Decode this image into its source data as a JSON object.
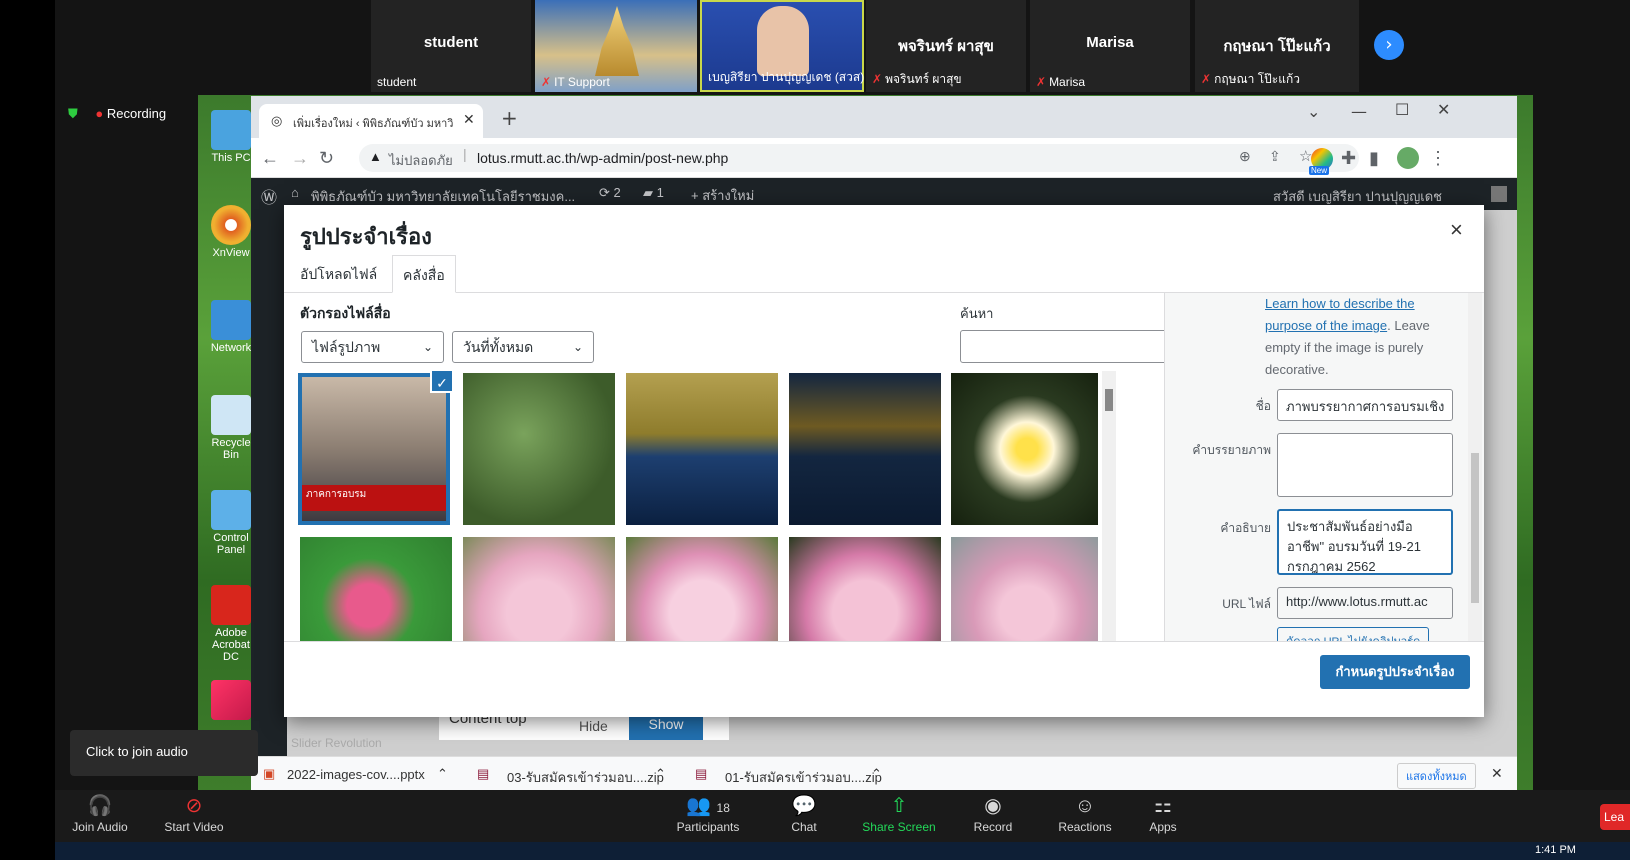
{
  "participants": [
    {
      "big": "student",
      "small": "student"
    },
    {
      "big": "",
      "small": "IT Support"
    },
    {
      "big": "",
      "small": "เบญสิรียา ปานปุญญเดช (สวส)"
    },
    {
      "big": "พจรินทร์ ผาสุข",
      "small": "พจรินทร์ ผาสุข"
    },
    {
      "big": "Marisa",
      "small": "Marisa"
    },
    {
      "big": "กฤษณา โป๊ะแก้ว",
      "small": "กฤษณา โป๊ะแก้ว"
    }
  ],
  "recording": "Recording",
  "desktop_icons": [
    "This PC",
    "XnView",
    "Network",
    "Recycle Bin",
    "Control Panel",
    "Adobe Acrobat DC",
    ""
  ],
  "browser": {
    "tab_title": "เพิ่มเรื่องใหม่ ‹ พิพิธภัณฑ์บัว มหาวิทยาลัย",
    "new_tab": "+",
    "insecure": "ไม่ปลอดภัย",
    "url": "lotus.rmutt.ac.th/wp-admin/post-new.php",
    "new_badge": "New"
  },
  "wp": {
    "site_name": "พิพิธภัณฑ์บัว มหาวิทยาลัยเทคโนโลยีราชมงค...",
    "updates": "2",
    "comments": "1",
    "new_label": "สร้างใหม่",
    "howdy": "สวัสดี เบญสิรียา ปานปุญญเดช",
    "content_top": "Content top",
    "hide": "Hide",
    "show": "Show",
    "slider": "Slider Revolution"
  },
  "modal": {
    "title": "รูปประจำเรื่อง",
    "close": "×",
    "tab_upload": "อัปโหลดไฟล์",
    "tab_library": "คลังสื่อ",
    "filter_label": "ตัวกรองไฟล์สื่อ",
    "filter_type": "ไฟล์รูปภาพ",
    "filter_date": "วันที่ทั้งหมด",
    "search_label": "ค้นหา",
    "thumb_caption": "ภาคการอบรม",
    "set_button": "กำหนดรูปประจำเรื่อง"
  },
  "sidebar": {
    "learn_link": "Learn how to describe the purpose of the image",
    "learn_rest": ". Leave empty if the image is purely decorative.",
    "title_label": "ชื่อ",
    "title_value": "ภาพบรรยากาศการอบรมเชิง",
    "caption_label": "คำบรรยายภาพ",
    "desc_label": "คำอธิบาย",
    "desc_value": "ประชาสัมพันธ์อย่างมืออาชีพ\" อบรมวันที่ 19-21 กรกฎาคม 2562",
    "url_label": "URL ไฟล์",
    "url_value": "http://www.lotus.rmutt.ac",
    "copy_button": "คัดลอก URL ไปยังคลิปบอร์ด"
  },
  "downloads": [
    "2022-images-cov....pptx",
    "03-รับสมัครเข้าร่วมอบ....zip",
    "01-รับสมัครเข้าร่วมอบ....zip"
  ],
  "downloads_show_all": "แสดงทั้งหมด",
  "tooltip": "Click to join audio",
  "zoom": {
    "join_audio": "Join Audio",
    "start_video": "Start Video",
    "participants": "Participants",
    "participants_count": "18",
    "chat": "Chat",
    "share": "Share Screen",
    "record": "Record",
    "reactions": "Reactions",
    "apps": "Apps",
    "leave": "Lea",
    "clock": "1:41 PM"
  },
  "colors": {
    "accent": "#2271b1",
    "share": "#23d959",
    "wpbar": "#1d2327"
  }
}
